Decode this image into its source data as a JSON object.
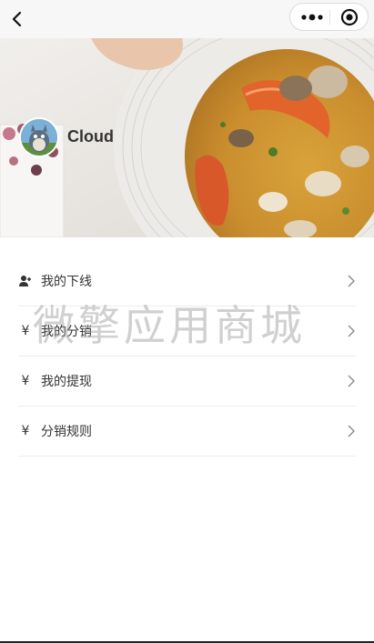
{
  "nav": {
    "back_icon": "back-chevron-icon",
    "more_icon": "more-dots-icon",
    "close_icon": "target-circle-icon"
  },
  "profile": {
    "username": "Cloud",
    "avatar_icon": "totoro-avatar"
  },
  "menu": {
    "items": [
      {
        "label": "我的下线",
        "icon": "user-plus-icon"
      },
      {
        "label": "我的分销",
        "icon": "yen-icon"
      },
      {
        "label": "我的提现",
        "icon": "yen-icon"
      },
      {
        "label": "分销规则",
        "icon": "yen-icon"
      }
    ]
  },
  "watermark": "微擎应用商城",
  "colors": {
    "nav_bg": "#f7f7f7",
    "divider": "#ececec",
    "text": "#333333"
  }
}
